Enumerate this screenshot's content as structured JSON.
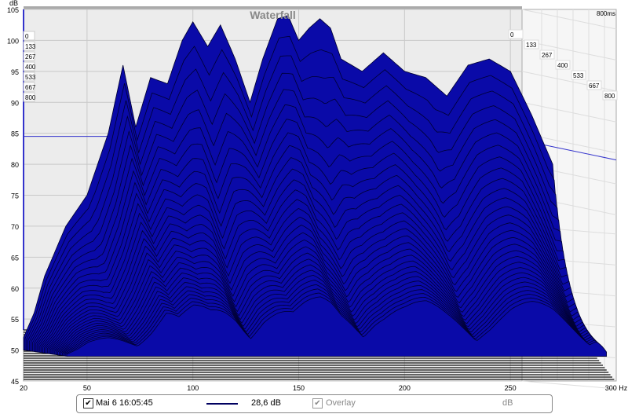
{
  "chart_data": {
    "type": "area",
    "title": "Waterfall",
    "ylabel": "dB",
    "xlabel": "Hz",
    "ylim": [
      45,
      105
    ],
    "xlim": [
      20,
      300
    ],
    "yticks": [
      45,
      50,
      55,
      60,
      65,
      70,
      75,
      80,
      85,
      90,
      95,
      100,
      105
    ],
    "xticks": [
      20,
      50,
      100,
      150,
      200,
      250,
      300
    ],
    "xtick_labels": [
      "20",
      "50",
      "100",
      "150",
      "200",
      "250",
      "300 Hz"
    ],
    "time_labels": [
      "0",
      "133",
      "267",
      "400",
      "533",
      "667",
      "800"
    ],
    "time_max_label": "800ms",
    "floor_db": 50,
    "front_response": {
      "freq": [
        20,
        25,
        30,
        40,
        50,
        60,
        67,
        73,
        80,
        88,
        95,
        100,
        107,
        113,
        120,
        127,
        133,
        140,
        145,
        150,
        155,
        160,
        165,
        170,
        180,
        190,
        200,
        210,
        220,
        230,
        240,
        250,
        260,
        270,
        275
      ],
      "db": [
        52,
        56,
        62,
        70,
        75,
        85,
        96,
        86,
        94,
        93,
        100,
        103,
        99,
        102.5,
        97,
        90,
        97,
        103.5,
        104,
        100,
        102,
        103.5,
        102,
        97,
        95,
        98,
        95,
        94,
        91,
        96,
        97,
        95,
        88,
        80,
        56
      ]
    },
    "series_color": "#0a0aa8",
    "level_marker_db": 84.5
  },
  "legend": {
    "checked": "✔",
    "name": "Mai 6 16:05:45",
    "value": "28,6 dB",
    "overlay": "Overlay",
    "unit": "dB"
  }
}
